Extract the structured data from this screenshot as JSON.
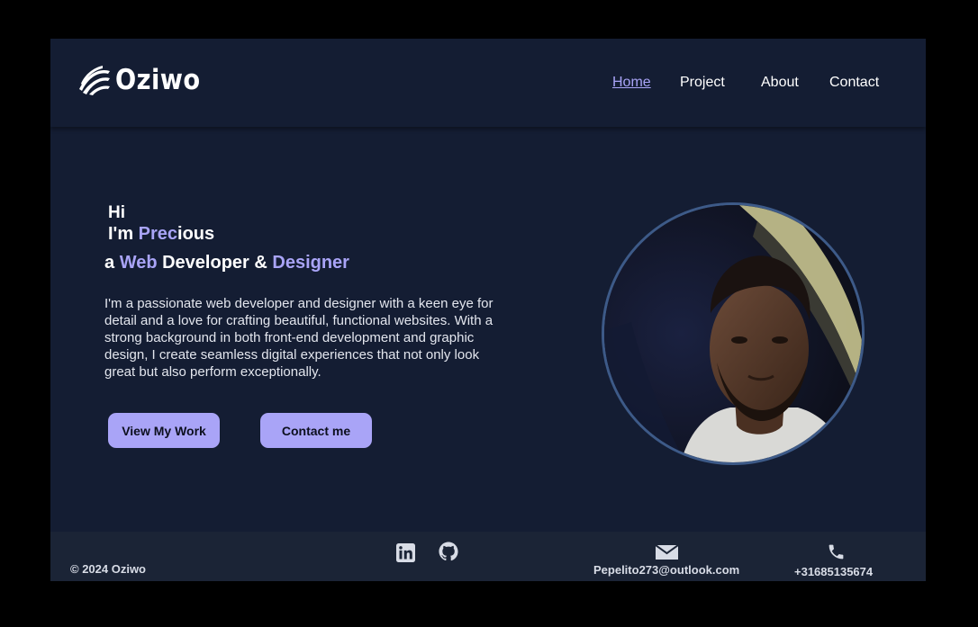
{
  "brand": {
    "logo_text": "Oziwo"
  },
  "nav": {
    "home": "Home",
    "project": "Project",
    "about": "About",
    "contact": "Contact",
    "active": "Home"
  },
  "hero": {
    "greeting": "Hi",
    "intro_prefix": "I'm ",
    "name_highlight": "Prec",
    "name_rest": "ious",
    "role_prefix": "a ",
    "role_web": "Web",
    "role_middle": " Developer & ",
    "role_designer": "Designer",
    "description": "I'm a passionate web developer and designer with a keen eye for detail and a love for crafting beautiful, functional websites. With a strong background in both front-end development and graphic design, I create seamless digital experiences that not only look great but also perform exceptionally.",
    "btn_work": "View My Work",
    "btn_contact": "Contact me"
  },
  "footer": {
    "copyright": "© 2024 Oziwo",
    "email": "Pepelito273@outlook.com",
    "phone": "+31685135674",
    "social_icons": [
      "linkedin-icon",
      "github-icon"
    ]
  },
  "colors": {
    "background": "#141d33",
    "accent": "#a9a4f7",
    "footer": "#1b2436",
    "outer": "#000000"
  }
}
